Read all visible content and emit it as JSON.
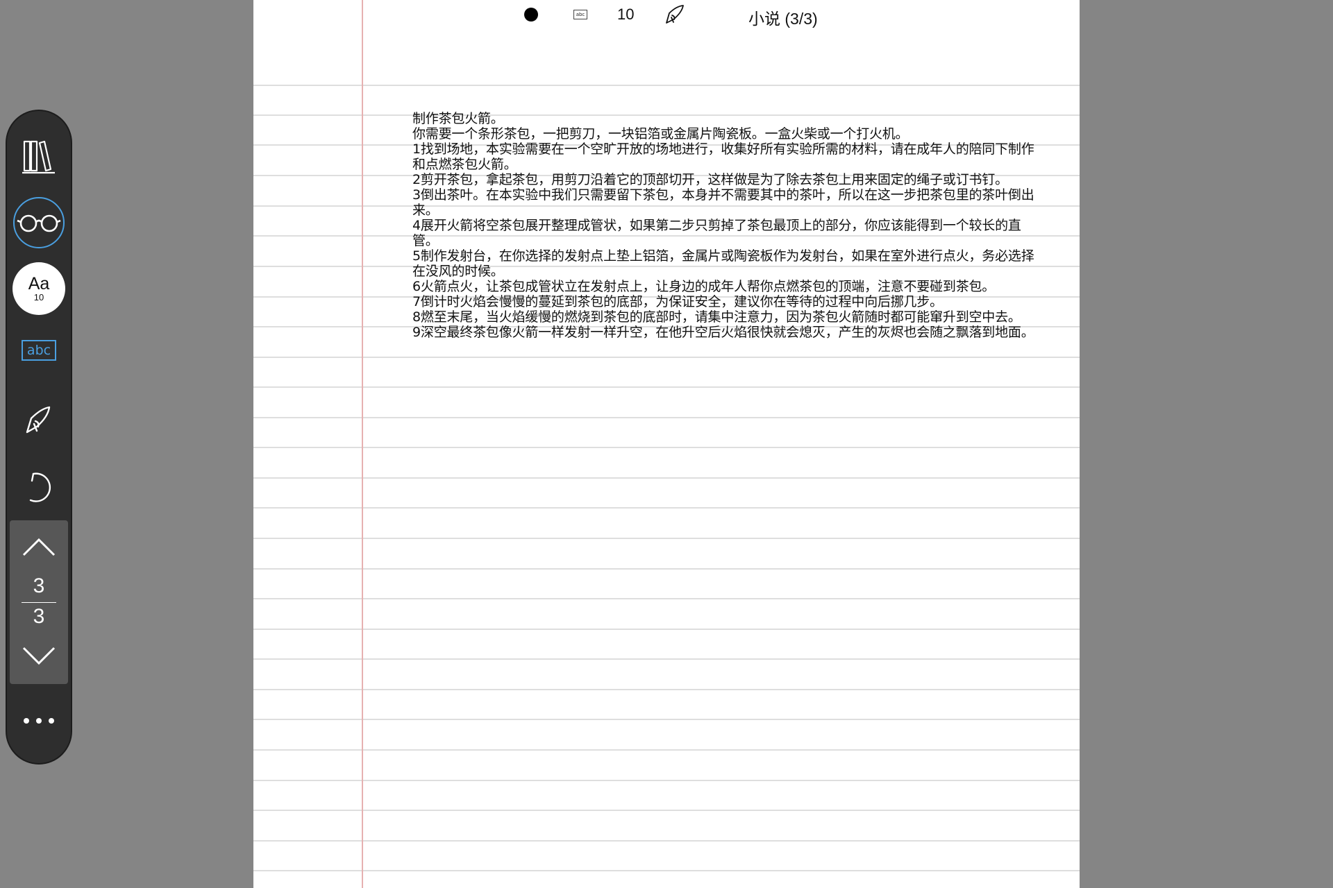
{
  "status_bar": {
    "abc_label": "abc",
    "font_size": "10",
    "title": "小说 (3/3)"
  },
  "sidebar": {
    "font_button": {
      "label": "Aa",
      "size": "10"
    },
    "abc_label": "abc",
    "page_nav": {
      "current": "3",
      "total": "3"
    }
  },
  "document": {
    "lines": [
      "制作茶包火箭。",
      "你需要一个条形茶包，一把剪刀，一块铝箔或金属片陶瓷板。一盒火柴或一个打火机。",
      "1找到场地，本实验需要在一个空旷开放的场地进行，收集好所有实验所需的材料，请在成年人的陪同下制作和点燃茶包火箭。",
      "2剪开茶包，拿起茶包，用剪刀沿着它的顶部切开，这样做是为了除去茶包上用来固定的绳子或订书钉。",
      "3倒出茶叶。在本实验中我们只需要留下茶包，本身并不需要其中的茶叶，所以在这一步把茶包里的茶叶倒出来。",
      "4展开火箭将空茶包展开整理成管状，如果第二步只剪掉了茶包最顶上的部分，你应该能得到一个较长的直管。",
      "5制作发射台，在你选择的发射点上垫上铝箔，金属片或陶瓷板作为发射台，如果在室外进行点火，务必选择在没风的时候。",
      "6火箭点火，让茶包成管状立在发射点上，让身边的成年人帮你点燃茶包的顶端，注意不要碰到茶包。",
      "7倒计时火焰会慢慢的蔓延到茶包的底部，为保证安全，建议你在等待的过程中向后挪几步。",
      "8燃至末尾，当火焰缓慢的燃烧到茶包的底部时，请集中注意力，因为茶包火箭随时都可能窜升到空中去。",
      "9深空最终茶包像火箭一样发射一样升空，在他升空后火焰很快就会熄灭，产生的灰烬也会随之飘落到地面。"
    ]
  },
  "colors": {
    "background": "#858585",
    "sidebar": "#2e2e2e",
    "accent": "#4a9fe0",
    "margin_line": "#e6b1b1"
  },
  "icons": {
    "library": "library-icon",
    "reading_mode": "glasses-icon",
    "pen": "pen-icon",
    "undo": "undo-icon",
    "page_up": "chevron-up-icon",
    "page_down": "chevron-down-icon",
    "more": "more-icon"
  }
}
